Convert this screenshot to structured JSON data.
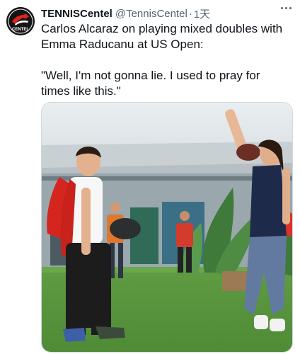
{
  "tweet": {
    "author": {
      "display_name": "TENNISCentel",
      "handle": "@TennisCentel",
      "separator": "·",
      "time": "1天",
      "avatar_text": "CENTEL"
    },
    "text_lines": [
      "Carlos Alcaraz on playing mixed doubles with Emma Raducanu at US Open:",
      "\"Well, I'm not gonna lie. I used to pray for times like this.\""
    ],
    "more_icon": "more-horizontal-icon"
  },
  "colors": {
    "text_primary": "#0f1419",
    "text_secondary": "#536471",
    "grass": "#5d9a3f",
    "avatar_red": "#e2231a"
  }
}
